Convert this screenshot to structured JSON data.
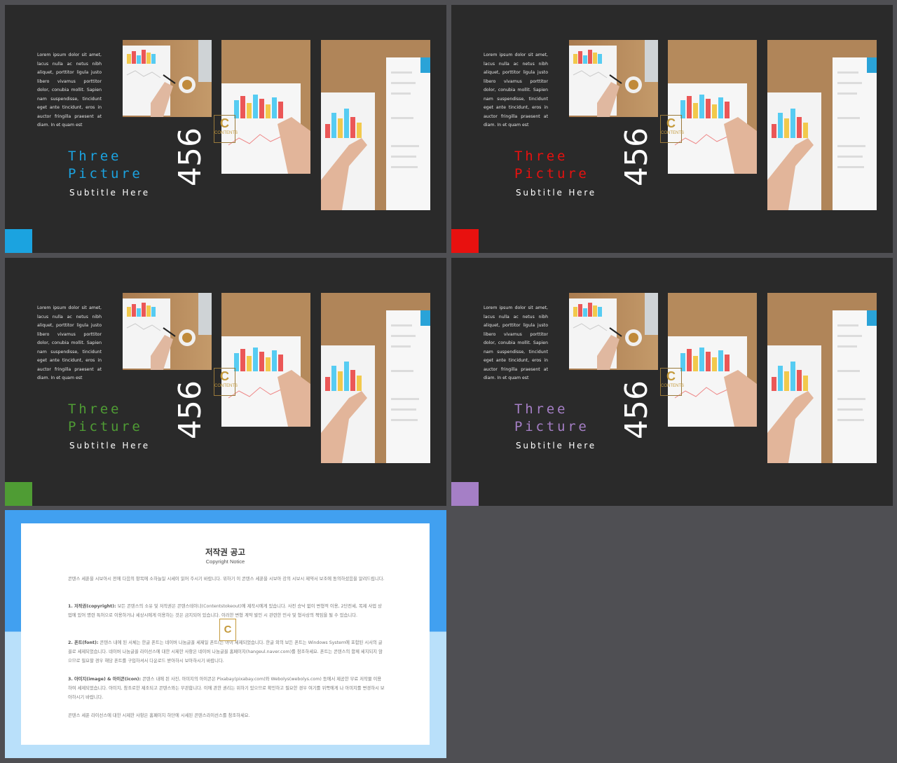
{
  "slides": [
    {
      "body": "Lorem ipsum dolor sit amet, lacus nulla ac netus nibh aliquet, porttitor ligula justo libero vivamus porttitor dolor, conubia mollit. Sapien nam suspendisse, tincidunt eget ante tincidunt, eros in auctor fringilla praesent at diam. In et quam est",
      "title_line1": "Three",
      "title_line2": "Picture",
      "subtitle": "Subtitle Here",
      "number": "456",
      "accent": "#1ba3e0"
    },
    {
      "body": "Lorem ipsum dolor sit amet, lacus nulla ac netus nibh aliquet, porttitor ligula justo libero vivamus porttitor dolor, conubia mollit. Sapien nam suspendisse, tincidunt eget ante tincidunt, eros in auctor fringilla praesent at diam. In et quam est",
      "title_line1": "Three",
      "title_line2": "Picture",
      "subtitle": "Subtitle Here",
      "number": "456",
      "accent": "#e8110f"
    },
    {
      "body": "Lorem ipsum dolor sit amet, lacus nulla ac netus nibh aliquet, porttitor ligula justo libero vivamus porttitor dolor, conubia mollit. Sapien nam suspendisse, tincidunt eget ante tincidunt, eros in auctor fringilla praesent at diam. In et quam est",
      "title_line1": "Three",
      "title_line2": "Picture",
      "subtitle": "Subtitle Here",
      "number": "456",
      "accent": "#4f9c34"
    },
    {
      "body": "Lorem ipsum dolor sit amet, lacus nulla ac netus nibh aliquet, porttitor ligula justo libero vivamus porttitor dolor, conubia mollit. Sapien nam suspendisse, tincidunt eget ante tincidunt, eros in auctor fringilla praesent at diam. In et quam est",
      "title_line1": "Three",
      "title_line2": "Picture",
      "subtitle": "Subtitle Here",
      "number": "456",
      "accent": "#a57fc6"
    }
  ],
  "copyright": {
    "title": "저작권 공고",
    "subtitle": "Copyright Notice",
    "intro": "콘텐스 세푼을 시보아시 전에 다음의 항목에 소하늘일 시세이 읽어 주시기 바랍니다. 위하기 이 콘텐스 세푼을 시보아 강의 시보시 제약서 보조에 동의하셨음을 알려드립니다.",
    "s1_head": "1. 저작권(copyright):",
    "s1_text": "보든 콘텐스의 소유 및 저작권은 콘텐스테이너(Contentstokeout)에 제작시에게 있습니다. 사전 승낙 없이 변형적 이용, 2단전세, 복제 사업 상업에 있어 명련 특허으로 이용하거나 세상시에게 이용하는 것은 금지되어 있습니다. 이러한 변형 계약 발인 시 관련한 민사 및 형사상의 책임을 될 수 있습니다.",
    "s2_head": "2. 폰트(font):",
    "s2_text": "콘텐스 내에 된 서체는 한글 폰트는 네이버 나눔글꼴 세제일 폰트(는 아이 세제되었습니다. 한글 외의 보든 폰트는 Windows System에 포함된 시서의 글꼴로 세제되었습니다. 네이버 나눔글꼴 라이선스에 대한 시제한 사항은 네이버 나눔글꼴 홈페이지(hangeul.naver.com)를 참조하세요. 폰트는 콘텐스의 함께 세지되지 않으므로 필요할 경우 해당 폰트를 구입하셔서 다운로드 받아하시 보아하시기 바랍니다.",
    "s3_head": "3. 아미지(image) & 아이콘(icon):",
    "s3_text": "콘텐스 내에 된 사진, 아미지의 아이콘은 Pixabay(pixabay.com)와 Webolys(webolys.com) 등에서 제공한 무료 저작물 이용하여 세제되었습니다. 아미지, 참조로한 제조되고 콘텐스와는 무관합니다. 이에 관한 권리는 위하기 있으므로 확인하고 필요한 경우 여기를 위쪽에게 나 아미지를 변경하시 보아하시기 바랍니다.",
    "closing": "콘텐스 세푼 라이선스에 대한 시제한 사항은 홈페이지 하단에 시세된 콘텐스라이선스를 참조하세요.",
    "logo": "C"
  },
  "logo_mark": "C",
  "logo_caption": "CONTENTS"
}
